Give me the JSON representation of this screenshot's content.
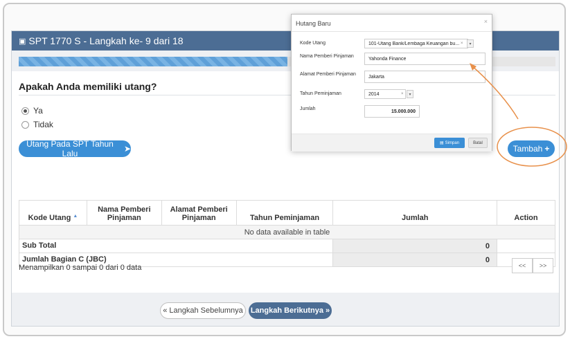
{
  "panel": {
    "title_icon": "briefcase-icon",
    "title": "SPT 1770 S - Langkah ke- 9 dari 18",
    "progress_fraction": 0.5
  },
  "question": {
    "text": "Apakah Anda memiliki utang?",
    "options": [
      {
        "label": "Ya",
        "selected": true
      },
      {
        "label": "Tidak",
        "selected": false
      }
    ]
  },
  "buttons": {
    "prev_year": "Utang Pada SPT Tahun Lalu",
    "prev_year_icon": "circle-arrow-right-icon",
    "add": "Tambah",
    "add_icon": "plus-icon"
  },
  "table": {
    "headers": [
      "Kode Utang",
      "Nama Pemberi Pinjaman",
      "Alamat Pemberi Pinjaman",
      "Tahun Peminjaman",
      "Jumlah",
      "Action"
    ],
    "empty_text": "No data available in table",
    "subtotal_label": "Sub Total",
    "subtotal_value": "0",
    "jbc_label": "Jumlah Bagian C (JBC)",
    "jbc_value": "0"
  },
  "footer": {
    "info": "Menampilkan 0 sampai 0 dari 0 data",
    "pager_prev": "<<",
    "pager_next": ">>"
  },
  "nav": {
    "prev": "« Langkah Sebelumnya",
    "next": "Langkah Berikutnya »"
  },
  "modal": {
    "title": "Hutang Baru",
    "close": "×",
    "fields": {
      "kode_label": "Kode Utang",
      "kode_value": "101-Utang Bank/Lembaga Keuangan bu...",
      "nama_label": "Nama Pemberi Pinjaman",
      "nama_value": "Yahonda Finance",
      "alamat_label": "Alamat Pemberi Pinjaman",
      "alamat_value": "Jakarta",
      "tahun_label": "Tahun Peminjaman",
      "tahun_value": "2014",
      "jumlah_label": "Jumlah",
      "jumlah_value": "15.000.000"
    },
    "save": "Simpan",
    "cancel": "Batal"
  },
  "colors": {
    "header": "#4c6d94",
    "accent": "#3b8fd6",
    "annotation": "#e8904a"
  }
}
